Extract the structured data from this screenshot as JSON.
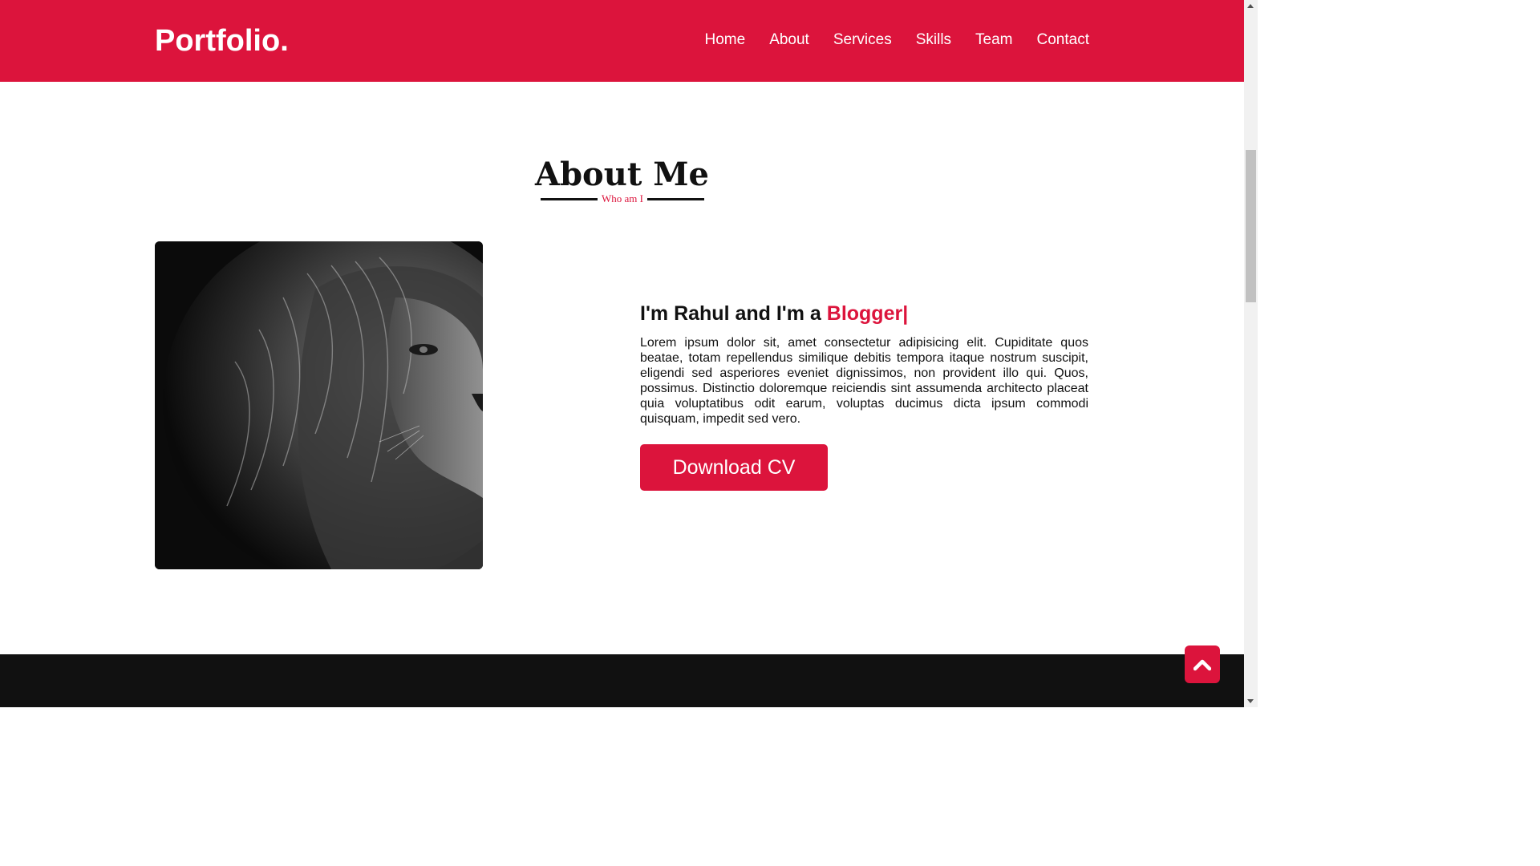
{
  "navbar": {
    "brand": "Portfolio.",
    "menu": [
      "Home",
      "About",
      "Services",
      "Skills",
      "Team",
      "Contact"
    ]
  },
  "about": {
    "title": "About Me",
    "subtitle": "Who am I",
    "photo_subject": "lion-portrait",
    "headline_prefix": "I'm Rahul and I'm a ",
    "headline_role": "Blogger|",
    "paragraph": "Lorem ipsum dolor sit, amet consectetur adipisicing elit. Cupiditate quos beatae, totam repellendus similique debitis tempora itaque nostrum suscipit, eligendi sed asperiores eveniet dignissimos, non provident illo qui. Quos, possimus. Distinctio doloremque reiciendis sint assumenda architecto placeat quia voluptatibus odit earum, voluptas ducimus dicta ipsum commodi quisquam, impedit sed vero.",
    "button_label": "Download CV"
  },
  "scroll_top": {
    "icon": "chevron-up-icon"
  },
  "colors": {
    "accent": "#dc143c",
    "dark": "#111111",
    "white": "#ffffff"
  }
}
